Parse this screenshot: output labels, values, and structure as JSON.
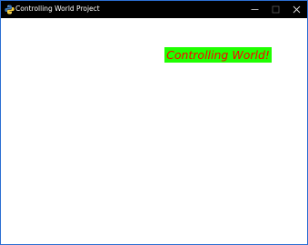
{
  "window": {
    "title": "Controlling World Project",
    "icon": "python-icon",
    "controls": {
      "minimize_icon": "minimize-icon",
      "maximize_icon": "maximize-icon",
      "close_icon": "close-icon"
    }
  },
  "canvas": {
    "banner_text": "Controlling World!",
    "banner_background": "#1fff00",
    "banner_text_color": "#ff0000"
  },
  "colors": {
    "titlebar_background": "#000000",
    "window_border": "#2b6fd3",
    "canvas_background": "#ffffff"
  }
}
